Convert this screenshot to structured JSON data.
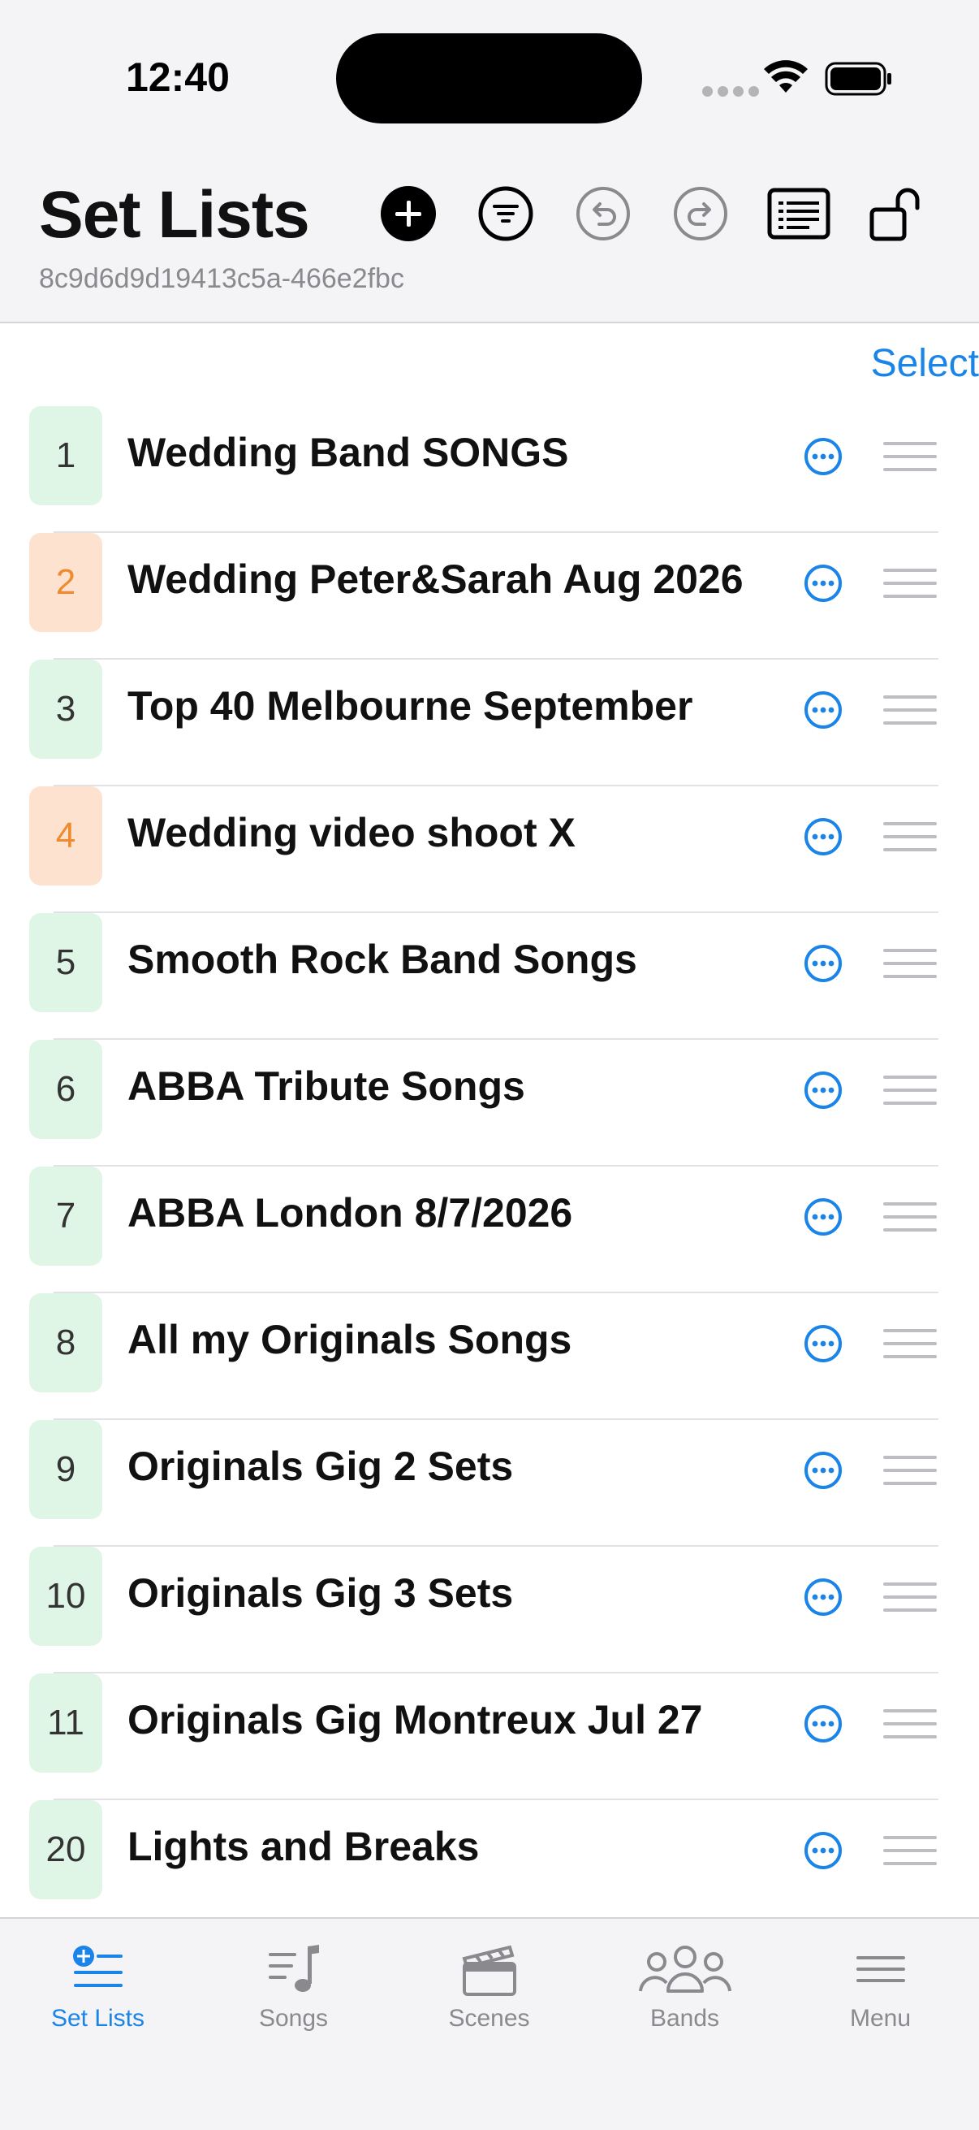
{
  "status_bar": {
    "time": "12:40"
  },
  "header": {
    "title": "Set Lists",
    "session_id": "8c9d6d9d19413c5a-466e2fbc",
    "icons": [
      "add-icon",
      "filter-icon",
      "undo-icon",
      "redo-icon",
      "list-view-icon",
      "unlock-icon"
    ]
  },
  "select_label": "Select",
  "colors": {
    "accent": "#1a84e8",
    "badge_green": "#dff5e6",
    "badge_orange": "#fde3cf",
    "orange_text": "#f08a2e"
  },
  "setlists": [
    {
      "number": "1",
      "title": "Wedding Band SONGS",
      "badge": "green"
    },
    {
      "number": "2",
      "title": "Wedding Peter&Sarah Aug 2026",
      "badge": "orange"
    },
    {
      "number": "3",
      "title": "Top 40 Melbourne September",
      "badge": "green"
    },
    {
      "number": "4",
      "title": "Wedding video shoot X",
      "badge": "orange"
    },
    {
      "number": "5",
      "title": "Smooth Rock Band Songs",
      "badge": "green"
    },
    {
      "number": "6",
      "title": "ABBA Tribute Songs",
      "badge": "green"
    },
    {
      "number": "7",
      "title": "ABBA London 8/7/2026",
      "badge": "green"
    },
    {
      "number": "8",
      "title": "All my Originals Songs",
      "badge": "green"
    },
    {
      "number": "9",
      "title": "Originals Gig 2 Sets",
      "badge": "green"
    },
    {
      "number": "10",
      "title": "Originals Gig 3 Sets",
      "badge": "green"
    },
    {
      "number": "11",
      "title": "Originals Gig Montreux Jul 27",
      "badge": "green"
    },
    {
      "number": "20",
      "title": "Lights and Breaks",
      "badge": "green"
    }
  ],
  "tabs": [
    {
      "label": "Set Lists",
      "icon": "setlist-add-icon",
      "active": true
    },
    {
      "label": "Songs",
      "icon": "music-list-icon",
      "active": false
    },
    {
      "label": "Scenes",
      "icon": "clapperboard-icon",
      "active": false
    },
    {
      "label": "Bands",
      "icon": "people-icon",
      "active": false
    },
    {
      "label": "Menu",
      "icon": "hamburger-icon",
      "active": false
    }
  ]
}
